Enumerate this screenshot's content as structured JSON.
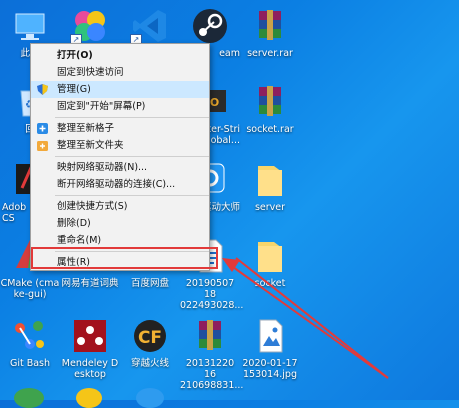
{
  "desktop_icons": {
    "this_pc": "此电",
    "colorful_app": "",
    "vscode": "",
    "steam": "eam",
    "server_rar": "server.rar",
    "recycle_bin": "回",
    "csgo": "ter-Stri\nobal...",
    "socket_rar": "socket.rar",
    "adobe": "Adob\nCS",
    "driver_master": "驱动大师",
    "server_folder": "server",
    "cmake": "CMake (cma\nke-gui)",
    "youdao": "网易有道词典",
    "baidu_disk": "百度网盘",
    "file_2019": "20190507 18\n022493028...",
    "socket_folder": "socket",
    "git_bash": "Git Bash",
    "mendeley": "Mendeley D\nesktop",
    "crossfire": "穿越火线",
    "archive_2013": "20131220 16\n210698831...",
    "image_2020": "2020-01-17\n153014.jpg"
  },
  "context_menu": {
    "items": [
      {
        "label": "打开(O)",
        "bold": true
      },
      {
        "label": "固定到快速访问"
      },
      {
        "label": "管理(G)",
        "highlight": true
      },
      {
        "label": "固定到\"开始\"屏幕(P)"
      },
      {
        "label": "整理至新格子"
      },
      {
        "label": "整理至新文件夹"
      },
      {
        "label": "映射网络驱动器(N)..."
      },
      {
        "label": "断开网络驱动器的连接(C)..."
      },
      {
        "label": "创建快捷方式(S)"
      },
      {
        "label": "删除(D)"
      },
      {
        "label": "重命名(M)"
      },
      {
        "label": "属性(R)"
      }
    ]
  },
  "colors": {
    "highlight": "#cce8ff",
    "annotation": "#e23a3a"
  }
}
